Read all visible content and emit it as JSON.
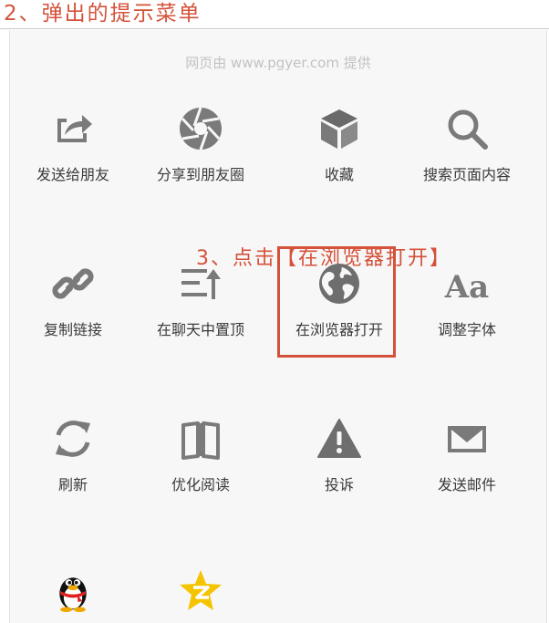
{
  "step_title": "2、弹出的提示菜单",
  "provider_note": "网页由 www.pgyer.com 提供",
  "annotation": "3、点击【在浏览器打开】",
  "colors": {
    "accent": "#d4523a",
    "icon": "#7a7a7a",
    "label": "#3a3a3a",
    "sheet_bg": "#f7f7f7"
  },
  "menu": {
    "row1": [
      {
        "label": "发送给朋友",
        "icon": "share-arrow-icon"
      },
      {
        "label": "分享到朋友圈",
        "icon": "moments-aperture-icon"
      },
      {
        "label": "收藏",
        "icon": "favorite-cube-icon"
      },
      {
        "label": "搜索页面内容",
        "icon": "search-icon"
      }
    ],
    "row2": [
      {
        "label": "复制链接",
        "icon": "link-icon"
      },
      {
        "label": "在聊天中置顶",
        "icon": "pin-to-top-icon"
      },
      {
        "label": "在浏览器打开",
        "icon": "globe-icon"
      },
      {
        "label": "调整字体",
        "icon": "font-size-icon"
      }
    ],
    "row3": [
      {
        "label": "刷新",
        "icon": "refresh-icon"
      },
      {
        "label": "优化阅读",
        "icon": "book-icon"
      },
      {
        "label": "投诉",
        "icon": "warning-icon"
      },
      {
        "label": "发送邮件",
        "icon": "mail-icon"
      }
    ],
    "row4": [
      {
        "label": "",
        "icon": "qq-penguin-icon"
      },
      {
        "label": "",
        "icon": "qzone-star-icon"
      }
    ]
  }
}
